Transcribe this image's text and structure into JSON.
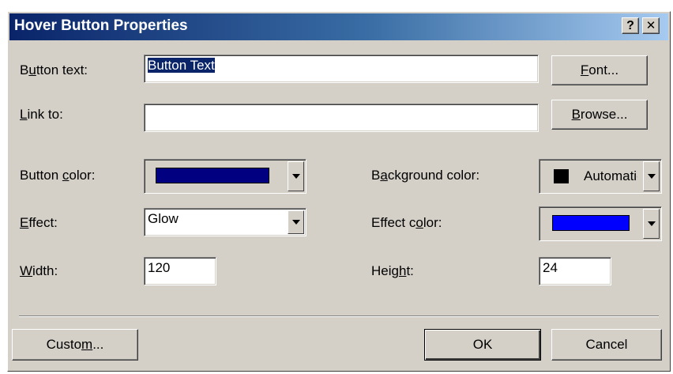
{
  "window": {
    "title": "Hover Button Properties",
    "help_label": "?",
    "close_label": "✕"
  },
  "button_text": {
    "label_pre": "B",
    "label_key": "u",
    "label_post": "tton text:",
    "value": "Button Text"
  },
  "font_button": {
    "key": "F",
    "rest": "ont..."
  },
  "link_to": {
    "label_pre": "",
    "label_key": "L",
    "label_post": "ink to:",
    "value": ""
  },
  "browse_button": {
    "key": "B",
    "rest": "rowse..."
  },
  "button_color": {
    "label_pre": "Button ",
    "label_key": "c",
    "label_post": "olor:",
    "color": "#000080"
  },
  "background_color": {
    "label_pre": "B",
    "label_key": "a",
    "label_post": "ckground color:",
    "swatch_color": "#000000",
    "value": "Automatic"
  },
  "effect": {
    "label_pre": "",
    "label_key": "E",
    "label_post": "ffect:",
    "value": "Glow"
  },
  "effect_color": {
    "label_pre": "Effect c",
    "label_key": "o",
    "label_post": "lor:",
    "color": "#0000ff"
  },
  "width": {
    "label_pre": "",
    "label_key": "W",
    "label_post": "idth:",
    "value": "120"
  },
  "height": {
    "label_pre": "Heig",
    "label_key": "h",
    "label_post": "t:",
    "value": "24"
  },
  "custom_button": {
    "pre": "Custo",
    "key": "m",
    "post": "..."
  },
  "ok_label": "OK",
  "cancel_label": "Cancel",
  "colors": {
    "face": "#d4d0c8",
    "title_start": "#0a246a",
    "title_end": "#a6caf0",
    "selection": "#0a246a"
  }
}
